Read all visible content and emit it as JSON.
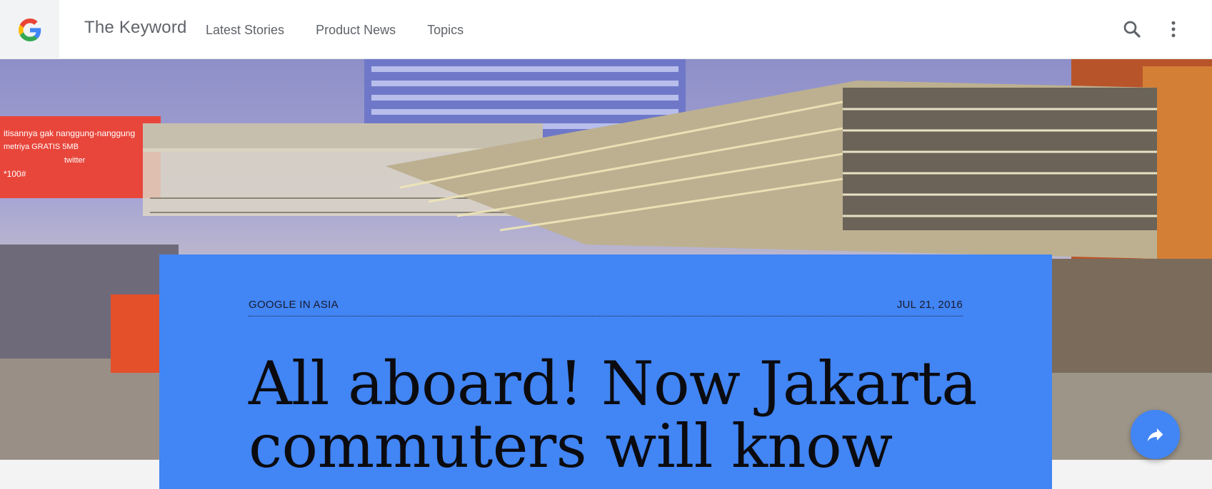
{
  "header": {
    "brand": "The Keyword",
    "nav": [
      "Latest Stories",
      "Product News",
      "Topics"
    ],
    "logo_icon": "google-g-logo",
    "search_icon": "search-icon",
    "more_icon": "more-vert-icon"
  },
  "hero": {
    "billboard_lines": [
      "itisannya gak nanggung-nanggung",
      "metriya GRATIS 5MB",
      "twitter",
      "*100#"
    ]
  },
  "article": {
    "category": "GOOGLE IN ASIA",
    "date": "JUL 21, 2016",
    "headline": "All aboard! Now Jakarta commuters will know"
  },
  "fab": {
    "icon": "share-icon"
  },
  "colors": {
    "accent": "#4285f4",
    "header_bg": "#ffffff",
    "text_muted": "#5f6368",
    "page_bg": "#f3f3f3"
  }
}
